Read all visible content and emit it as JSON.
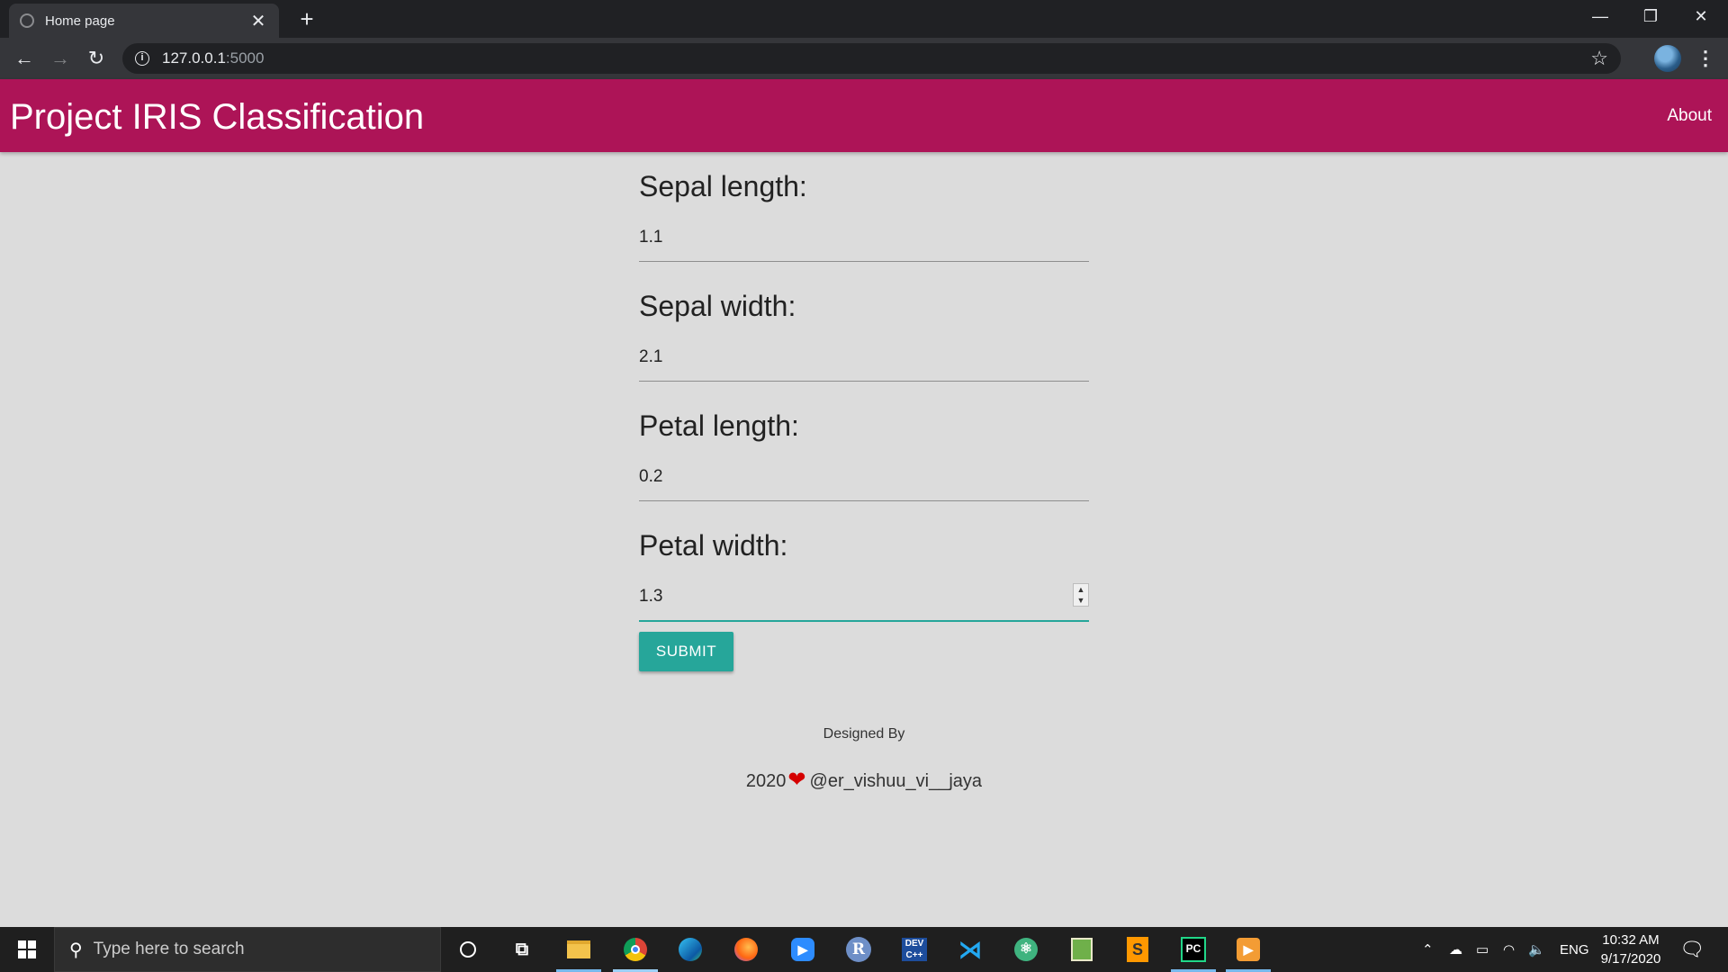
{
  "browser": {
    "tab_title": "Home page",
    "url_host": "127.0.0.1",
    "url_port": ":5000"
  },
  "navbar": {
    "brand": "Project IRIS Classification",
    "about": "About",
    "color": "#ad1457"
  },
  "form": {
    "fields": [
      {
        "label": "Sepal length:",
        "value": "1.1"
      },
      {
        "label": "Sepal width:",
        "value": "2.1"
      },
      {
        "label": "Petal length:",
        "value": "0.2"
      },
      {
        "label": "Petal width:",
        "value": "1.3"
      }
    ],
    "submit": "SUBMIT",
    "accent": "#26a69a"
  },
  "footer": {
    "designed_by": "Designed By",
    "year": "2020",
    "heart": "❤",
    "handle": "@er_vishuu_vi__jaya"
  },
  "taskbar": {
    "search_placeholder": "Type here to search",
    "language": "ENG",
    "time": "10:32 AM",
    "date": "9/17/2020",
    "apps": [
      "cortana-icon",
      "task-view-icon",
      "file-explorer-icon",
      "chrome-icon",
      "edge-icon",
      "firefox-icon",
      "zoom-icon",
      "r-icon",
      "dev-cpp-icon",
      "vscode-icon",
      "atom-icon",
      "notepad-icon",
      "sublime-text-icon",
      "pycharm-icon",
      "media-player-icon"
    ]
  }
}
